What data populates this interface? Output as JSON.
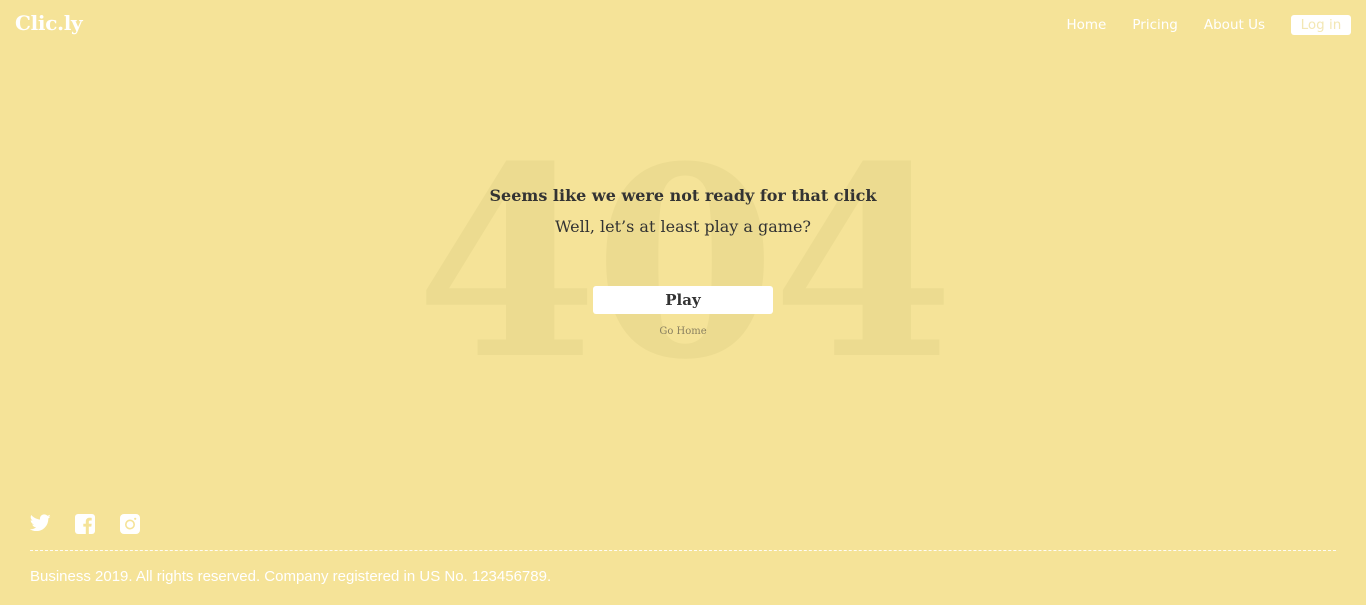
{
  "brand": {
    "logo_text": "Clic.ly"
  },
  "nav": {
    "items": [
      {
        "label": "Home"
      },
      {
        "label": "Pricing"
      },
      {
        "label": "About Us"
      }
    ],
    "login_label": "Log in"
  },
  "error": {
    "code": "404",
    "title": "Seems like we were not ready for that click",
    "subtitle": "Well, let’s at least play a game?",
    "play_label": "Play",
    "go_home_label": "Go Home"
  },
  "footer": {
    "social_icons": [
      "twitter-icon",
      "facebook-icon",
      "instagram-icon"
    ],
    "copyright": "Business 2019. All rights reserved. Company registered in US No. 123456789."
  },
  "colors": {
    "background": "#f5e398",
    "watermark": "#ecdb90",
    "text": "#333333",
    "white": "#ffffff"
  }
}
